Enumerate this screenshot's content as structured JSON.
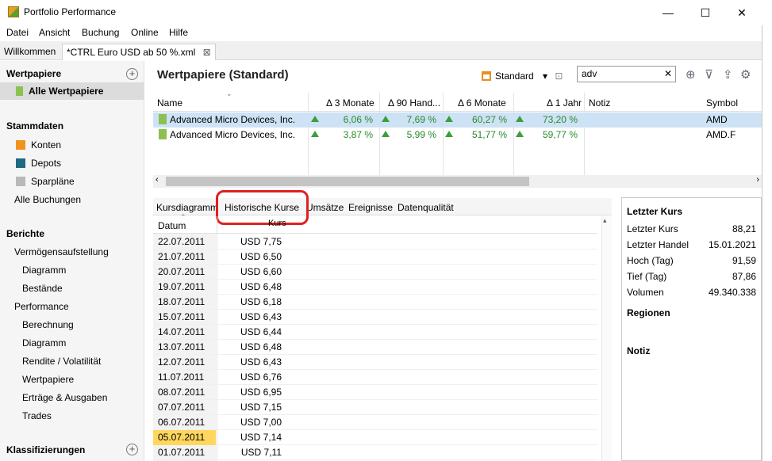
{
  "window": {
    "title": "Portfolio Performance",
    "minimize": "—",
    "maximize": "☐",
    "close": "✕"
  },
  "menu": [
    "Datei",
    "Ansicht",
    "Buchung",
    "Online",
    "Hilfe"
  ],
  "tabs": [
    {
      "label": "Willkommen"
    },
    {
      "label": "*CTRL Euro USD ab 50 %.xml",
      "close": "⊠"
    }
  ],
  "sidebar": {
    "wertpapiere": "Wertpapiere",
    "alle_wertpapiere": "Alle Wertpapiere",
    "stammdaten": "Stammdaten",
    "konten": "Konten",
    "depots": "Depots",
    "sparplaene": "Sparpläne",
    "alle_buchungen": "Alle Buchungen",
    "berichte": "Berichte",
    "vermoegen": "Vermögensaufstellung",
    "diagramm1": "Diagramm",
    "bestaende": "Bestände",
    "performance": "Performance",
    "berechnung": "Berechnung",
    "diagramm2": "Diagramm",
    "rendite": "Rendite / Volatilität",
    "wertpapiere2": "Wertpapiere",
    "ertraege": "Erträge & Ausgaben",
    "trades": "Trades",
    "klassifizierungen": "Klassifizierungen",
    "colors": {
      "konten": "#f0921e",
      "depots": "#1f6a80",
      "sparplaene": "#b8b8b8"
    }
  },
  "main": {
    "title": "Wertpapiere (Standard)",
    "view_label": "Standard",
    "search_value": "adv",
    "search_clear": "✕"
  },
  "table": {
    "columns": [
      "Name",
      "Δ 3 Monate",
      "Δ 90 Hand...",
      "Δ 6 Monate",
      "Δ 1 Jahr",
      "Notiz",
      "Symbol"
    ],
    "rows": [
      {
        "name": "Advanced Micro Devices, Inc.",
        "d3m": "6,06 %",
        "d90": "7,69 %",
        "d6m": "60,27 %",
        "d1y": "73,20 %",
        "symbol": "AMD"
      },
      {
        "name": "Advanced Micro Devices, Inc.",
        "d3m": "3,87 %",
        "d90": "5,99 %",
        "d6m": "51,77 %",
        "d1y": "59,77 %",
        "symbol": "AMD.F"
      }
    ]
  },
  "subtabs": [
    "Kursdiagramm",
    "Historische Kurse",
    "Umsätze",
    "Ereignisse",
    "Datenqualität"
  ],
  "prices": {
    "headers": {
      "date": "Datum",
      "price": "Kurs"
    },
    "rows": [
      {
        "date": "22.07.2011",
        "price": "USD 7,75"
      },
      {
        "date": "21.07.2011",
        "price": "USD 6,50"
      },
      {
        "date": "20.07.2011",
        "price": "USD 6,60"
      },
      {
        "date": "19.07.2011",
        "price": "USD 6,48"
      },
      {
        "date": "18.07.2011",
        "price": "USD 6,18"
      },
      {
        "date": "15.07.2011",
        "price": "USD 6,43"
      },
      {
        "date": "14.07.2011",
        "price": "USD 6,44"
      },
      {
        "date": "13.07.2011",
        "price": "USD 6,48"
      },
      {
        "date": "12.07.2011",
        "price": "USD 6,43"
      },
      {
        "date": "11.07.2011",
        "price": "USD 6,76"
      },
      {
        "date": "08.07.2011",
        "price": "USD 6,95"
      },
      {
        "date": "07.07.2011",
        "price": "USD 7,15"
      },
      {
        "date": "06.07.2011",
        "price": "USD 7,00"
      },
      {
        "date": "05.07.2011",
        "price": "USD 7,14"
      },
      {
        "date": "01.07.2011",
        "price": "USD 7,11"
      }
    ]
  },
  "panel": {
    "heading": "Letzter Kurs",
    "items": [
      {
        "label": "Letzter Kurs",
        "value": "88,21"
      },
      {
        "label": "Letzter Handel",
        "value": "15.01.2021"
      },
      {
        "label": "Hoch (Tag)",
        "value": "91,59"
      },
      {
        "label": "Tief (Tag)",
        "value": "87,86"
      },
      {
        "label": "Volumen",
        "value": "49.340.338"
      }
    ],
    "regionen": "Regionen",
    "notiz": "Notiz"
  }
}
